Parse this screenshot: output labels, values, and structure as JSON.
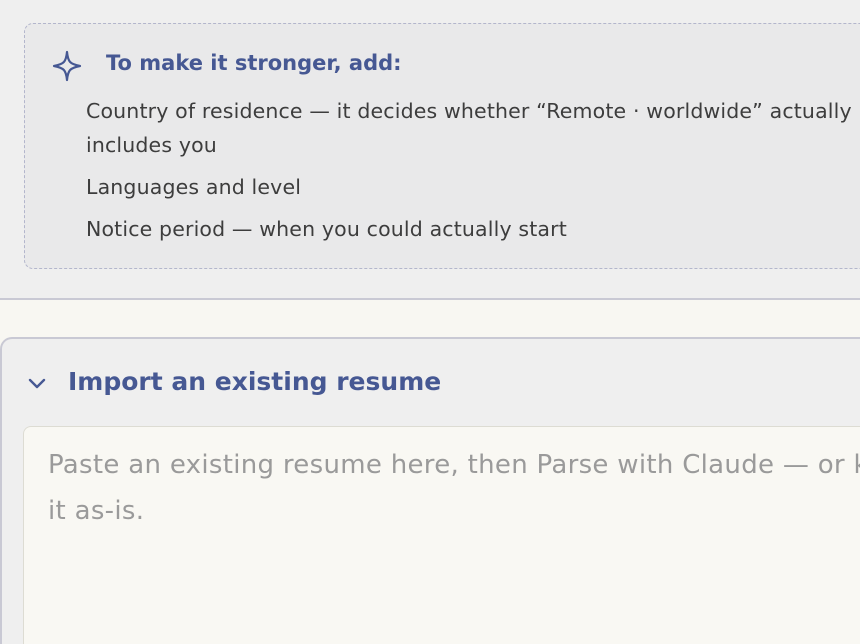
{
  "tips": {
    "title": "To make it stronger, add:",
    "icon": "sparkle-icon",
    "items": [
      "Country of residence — it decides whether “Remote · worldwide” actually",
      "includes you",
      "Languages and level",
      "Notice period — when you could actually start"
    ]
  },
  "import": {
    "toggle_label": "Import an existing resume",
    "icon": "chevron-down-icon",
    "placeholder_line1": "Paste an existing resume here, then Parse with Claude — or keep",
    "placeholder_line2": "it as-is."
  },
  "colors": {
    "accent": "#465893",
    "panel": "#efefef",
    "page": "#f8f7f2"
  }
}
